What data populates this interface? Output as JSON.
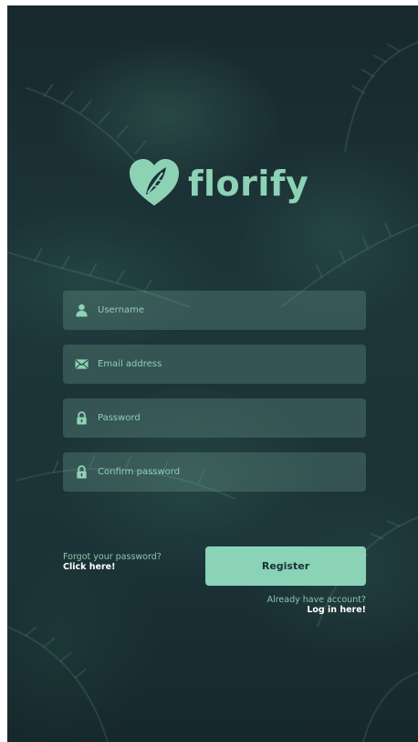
{
  "brand": {
    "name": "florify",
    "accent_color": "#8ed2b6",
    "background_color": "#1b3236"
  },
  "form": {
    "username": {
      "placeholder": "Username",
      "icon": "person-icon"
    },
    "email": {
      "placeholder": "Email address",
      "icon": "envelope-icon"
    },
    "password": {
      "placeholder": "Password",
      "icon": "lock-icon"
    },
    "confirm_password": {
      "placeholder": "Confirm password",
      "icon": "lock-icon"
    }
  },
  "forgot": {
    "text": "Forgot your password?",
    "link": "Click here!"
  },
  "register": {
    "label": "Register"
  },
  "login": {
    "text": "Already have account?",
    "link": "Log in here!"
  }
}
